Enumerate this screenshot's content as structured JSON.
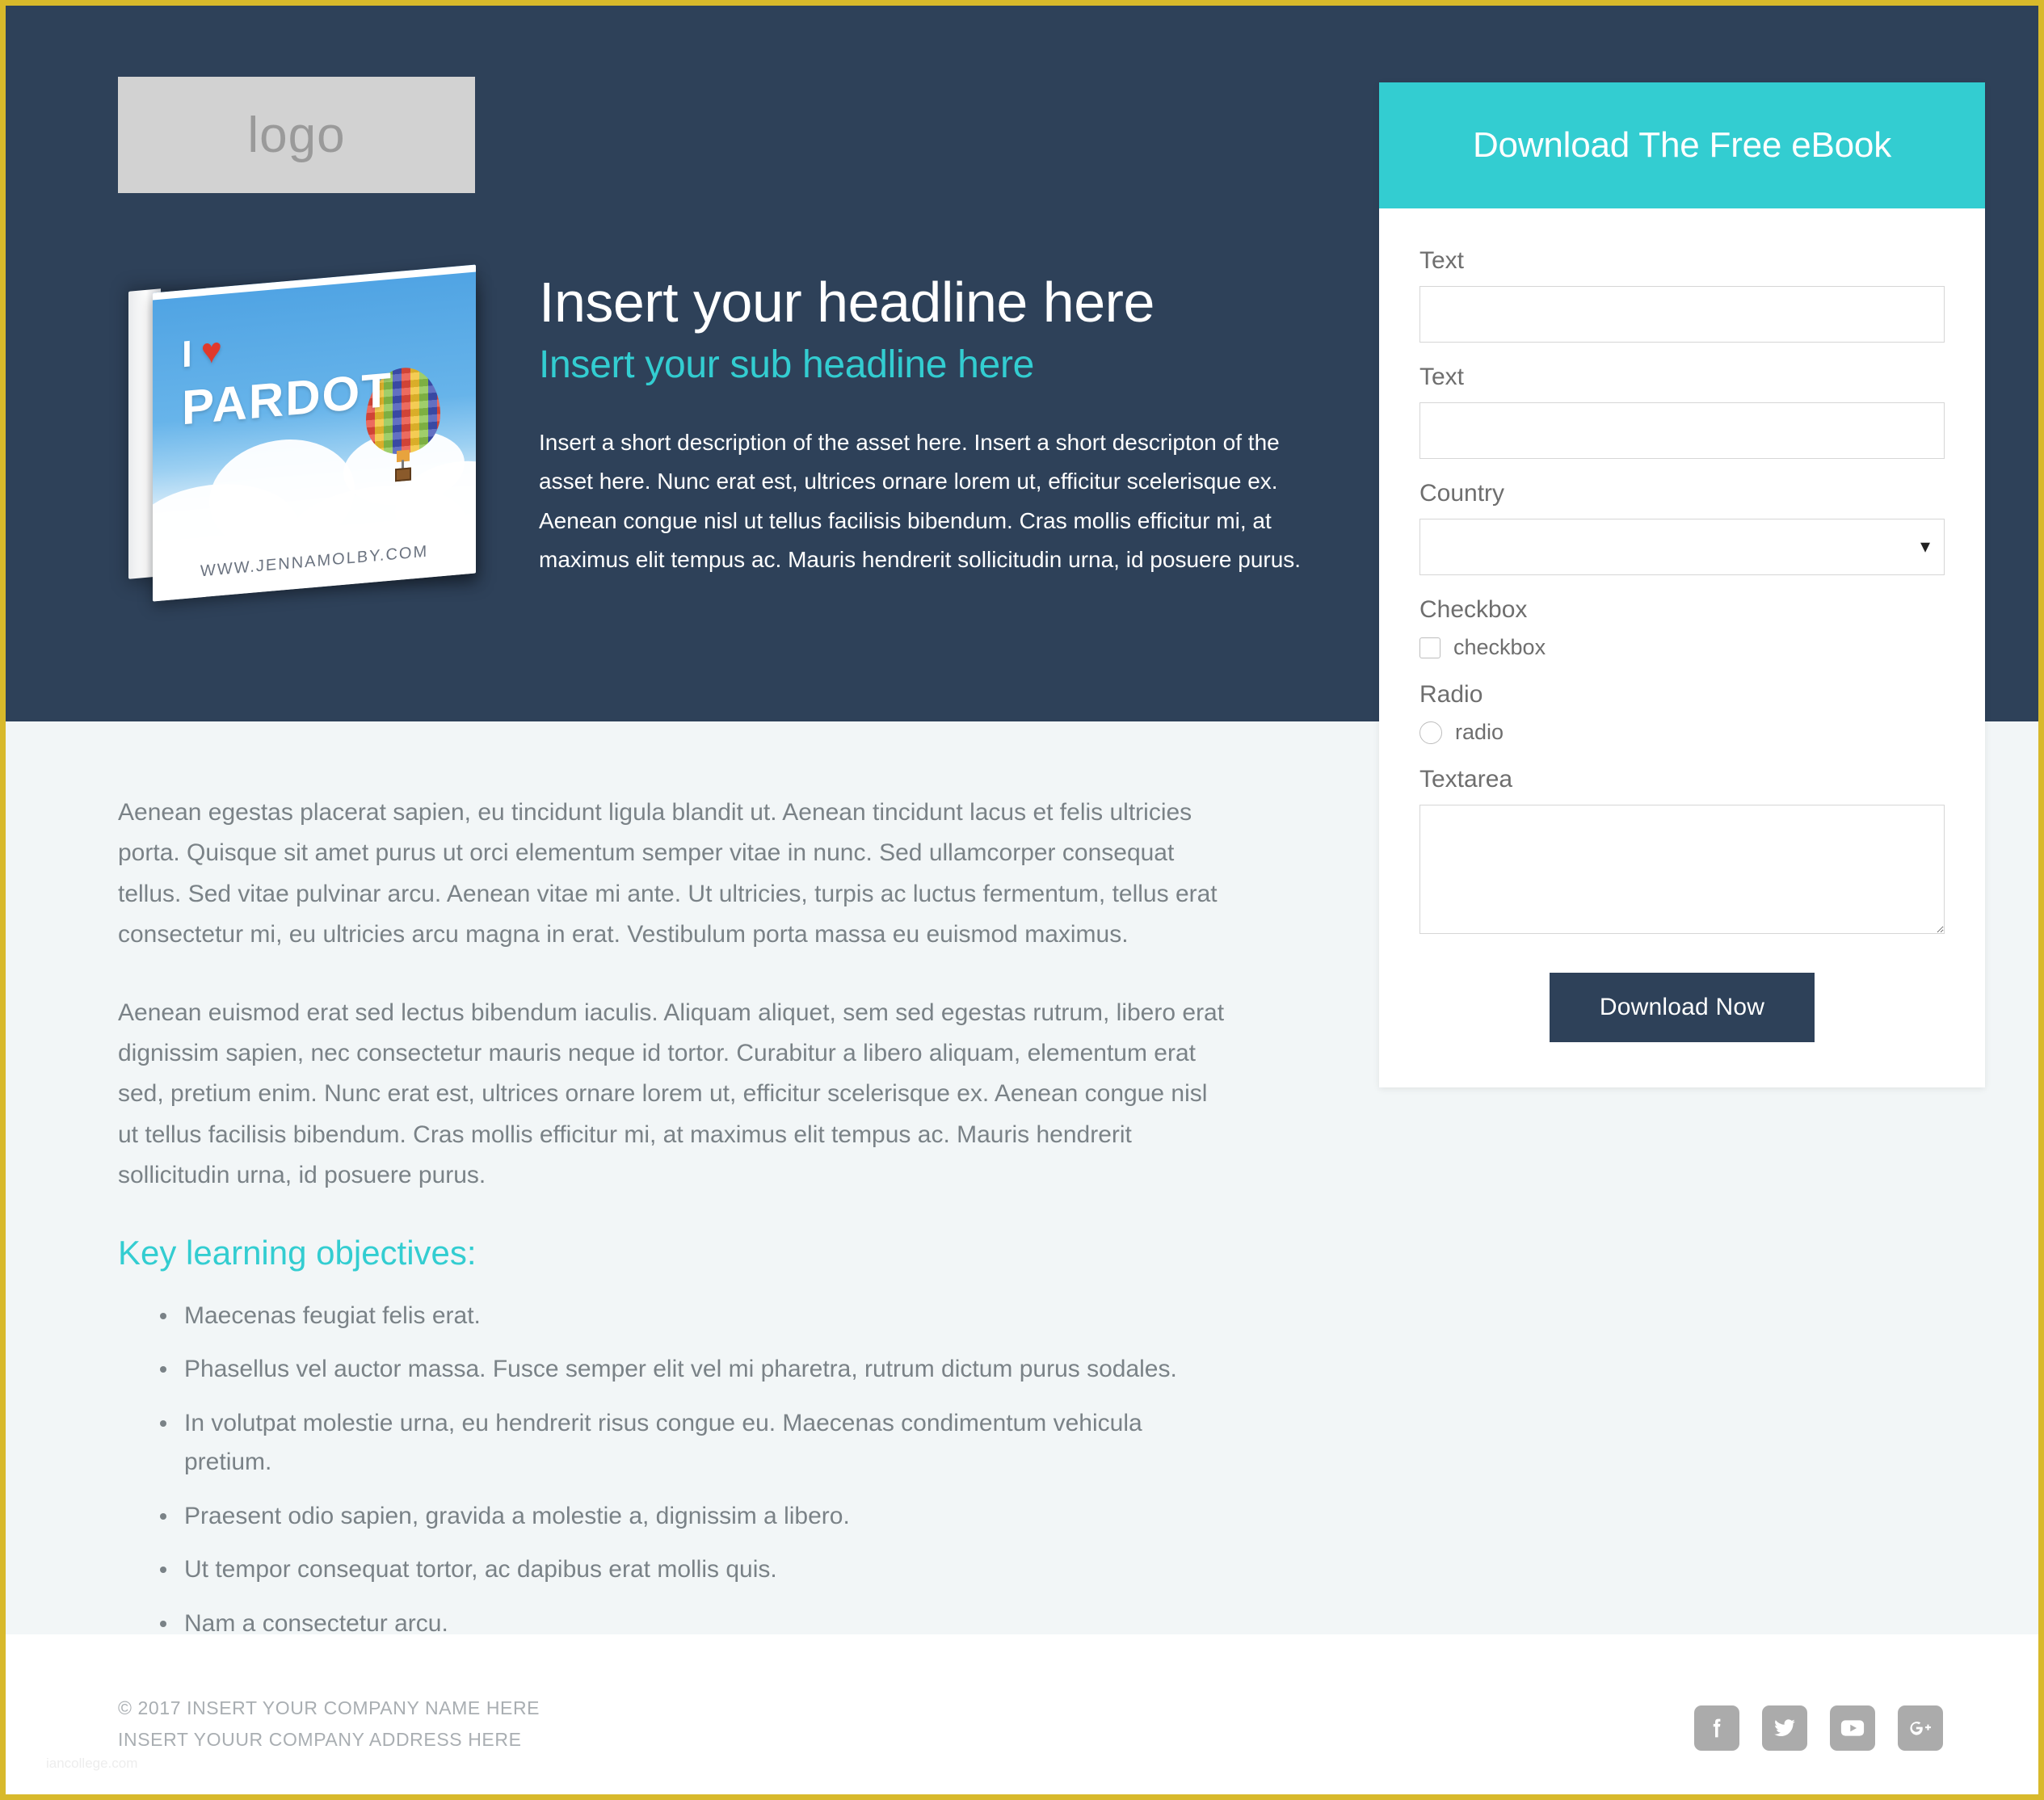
{
  "theme": {
    "hero_bg": "#2E4159",
    "accent_teal": "#33CDD1",
    "body_bg": "#F2F6F7",
    "page_border": "#D8B92B",
    "muted_text": "#7A8287"
  },
  "hero": {
    "logo_placeholder": "logo",
    "ebook_cover": {
      "line1": "I",
      "heart": "♥",
      "line2": "PARDOT",
      "url": "WWW.JENNAMOLBY.COM"
    },
    "headline": "Insert your headline here",
    "subheadline": "Insert your sub headline here",
    "description": "Insert a short description of the asset here. Insert a short descripton of the asset here. Nunc erat est, ultrices ornare lorem ut, efficitur scelerisque ex. Aenean congue nisl ut tellus facilisis bibendum. Cras mollis efficitur mi, at maximus elit tempus ac. Mauris hendrerit sollicitudin urna, id posuere purus."
  },
  "form": {
    "title": "Download The Free eBook",
    "fields": [
      {
        "label": "Text",
        "type": "text",
        "value": "",
        "placeholder": ""
      },
      {
        "label": "Text",
        "type": "text",
        "value": "",
        "placeholder": ""
      },
      {
        "label": "Country",
        "type": "select",
        "value": "",
        "options": [
          ""
        ]
      },
      {
        "label": "Checkbox",
        "type": "checkbox",
        "option_label": "checkbox",
        "checked": false
      },
      {
        "label": "Radio",
        "type": "radio",
        "option_label": "radio",
        "checked": false
      },
      {
        "label": "Textarea",
        "type": "textarea",
        "value": "",
        "placeholder": ""
      }
    ],
    "submit_label": "Download Now"
  },
  "content": {
    "paragraphs": [
      "Aenean egestas placerat sapien, eu tincidunt ligula blandit ut. Aenean tincidunt lacus et felis ultricies porta. Quisque sit amet purus ut orci elementum semper vitae in nunc. Sed ullamcorper consequat tellus. Sed vitae pulvinar arcu. Aenean vitae mi ante. Ut ultricies, turpis ac luctus fermentum, tellus erat consectetur mi, eu ultricies arcu magna in erat. Vestibulum porta massa eu euismod maximus.",
      "Aenean euismod erat sed lectus bibendum iaculis. Aliquam aliquet, sem sed egestas rutrum, libero erat dignissim sapien, nec consectetur mauris neque id tortor. Curabitur a libero aliquam, elementum erat sed, pretium enim. Nunc erat est, ultrices ornare lorem ut, efficitur scelerisque ex. Aenean congue nisl ut tellus facilisis bibendum. Cras mollis efficitur mi, at maximus elit tempus ac. Mauris hendrerit sollicitudin urna, id posuere purus."
    ],
    "objectives_title": "Key learning objectives:",
    "objectives": [
      "Maecenas feugiat felis erat.",
      "Phasellus vel auctor massa. Fusce semper elit vel mi pharetra, rutrum dictum purus sodales.",
      "In volutpat molestie urna, eu hendrerit risus congue eu. Maecenas condimentum vehicula pretium.",
      "Praesent odio sapien, gravida a molestie a, dignissim a libero.",
      "Ut tempor consequat tortor, ac dapibus erat mollis quis.",
      "Nam a consectetur arcu."
    ]
  },
  "footer": {
    "copyright": "© 2017 INSERT YOUR COMPANY NAME HERE",
    "address": "INSERT YOUUR COMPANY ADDRESS HERE",
    "watermark": "iancollege.com",
    "social": [
      {
        "name": "facebook",
        "label": "Facebook"
      },
      {
        "name": "twitter",
        "label": "Twitter"
      },
      {
        "name": "youtube",
        "label": "YouTube"
      },
      {
        "name": "googleplus",
        "label": "Google Plus"
      }
    ]
  }
}
